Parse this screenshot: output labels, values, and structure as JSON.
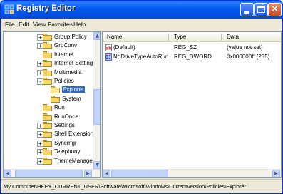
{
  "window": {
    "title": "Registry Editor"
  },
  "menu": [
    "File",
    "Edit",
    "View",
    "Favorites",
    "Help"
  ],
  "tree": {
    "items": [
      {
        "label": "Group Policy",
        "expander": "+"
      },
      {
        "label": "GrpConv",
        "expander": "+"
      },
      {
        "label": "Internet",
        "expander": ""
      },
      {
        "label": "Internet Settings",
        "expander": "+"
      },
      {
        "label": "Multimedia",
        "expander": "+"
      },
      {
        "label": "Policies",
        "expander": "-"
      },
      {
        "label": "Explorer",
        "expander": "",
        "selected": true,
        "child": true
      },
      {
        "label": "System",
        "expander": "",
        "child": true
      },
      {
        "label": "Run",
        "expander": ""
      },
      {
        "label": "RunOnce",
        "expander": ""
      },
      {
        "label": "Settings",
        "expander": "+"
      },
      {
        "label": "Shell Extensions",
        "expander": "+"
      },
      {
        "label": "Syncmgr",
        "expander": "+"
      },
      {
        "label": "Telephony",
        "expander": "+"
      },
      {
        "label": "ThemeManager",
        "expander": "+"
      }
    ]
  },
  "list": {
    "columns": {
      "name": "Name",
      "type": "Type",
      "data": "Data"
    },
    "rows": [
      {
        "name": "(Default)",
        "type": "REG_SZ",
        "data": "(value not set)",
        "icon": "string-value-icon"
      },
      {
        "name": "NoDriveTypeAutoRun",
        "type": "REG_DWORD",
        "data": "0x000000ff (255)",
        "icon": "dword-value-icon"
      }
    ]
  },
  "status": {
    "path": "My Computer\\HKEY_CURRENT_USER\\Software\\Microsoft\\Windows\\CurrentVersion\\Policies\\Explorer"
  },
  "colors": {
    "titlebar": "#0058ee",
    "selection": "#316ac5",
    "close_button": "#c44a1f"
  }
}
